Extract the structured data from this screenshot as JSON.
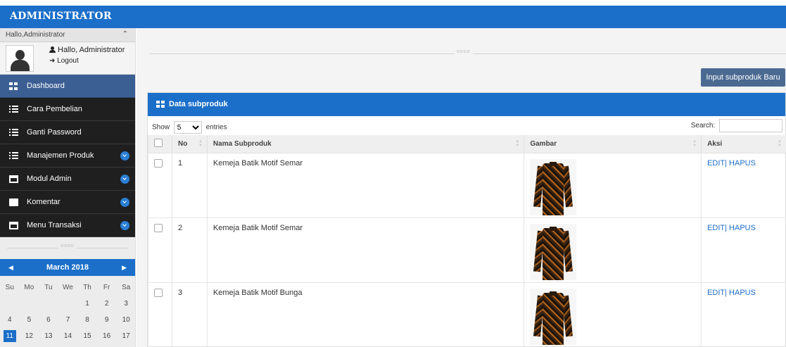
{
  "app": {
    "title": "ADMINISTRATOR"
  },
  "user": {
    "header": "Hallo,Administrator",
    "greeting": "Hallo, Administrator",
    "logout": "Logout"
  },
  "nav": [
    {
      "label": "Dashboard",
      "icon": "grid-icon",
      "active": true
    },
    {
      "label": "Cara Pembelian",
      "icon": "list-icon"
    },
    {
      "label": "Ganti Password",
      "icon": "list-icon"
    },
    {
      "label": "Manajemen Produk",
      "icon": "list-icon",
      "expandable": true
    },
    {
      "label": "Modul Admin",
      "icon": "box-icon",
      "expandable": true
    },
    {
      "label": "Komentar",
      "icon": "comment-icon",
      "expandable": true
    },
    {
      "label": "Menu Transaksi",
      "icon": "box-icon",
      "expandable": true
    }
  ],
  "separator": "oooo",
  "calendar": {
    "month": "March 2018",
    "weekdays": [
      "Su",
      "Mo",
      "Tu",
      "We",
      "Th",
      "Fr",
      "Sa"
    ],
    "weeks": [
      [
        "",
        "",
        "",
        "",
        "1",
        "2",
        "3"
      ],
      [
        "4",
        "5",
        "6",
        "7",
        "8",
        "9",
        "10"
      ],
      [
        "11",
        "12",
        "13",
        "14",
        "15",
        "16",
        "17"
      ]
    ],
    "today": "11"
  },
  "main": {
    "new_button": "Input subproduk Baru",
    "panel_title": "Data subproduk",
    "show_label": "Show",
    "show_value": "5",
    "entries_label": "entries",
    "search_label": "Search:",
    "columns": [
      "No",
      "Nama Subproduk",
      "Gambar",
      "Aksi"
    ],
    "rows": [
      {
        "no": "1",
        "name": "Kemeja Batik Motif Semar",
        "action": "EDIT| HAPUS"
      },
      {
        "no": "2",
        "name": "Kemeja Batik Motif Semar",
        "action": "EDIT| HAPUS"
      },
      {
        "no": "3",
        "name": "Kemeja Batik Motif Bunga",
        "action": "EDIT| HAPUS"
      }
    ]
  },
  "colors": {
    "primary": "#1b6fc9",
    "sidebar_dark": "#1f1f1f",
    "active": "#3c5f93"
  }
}
